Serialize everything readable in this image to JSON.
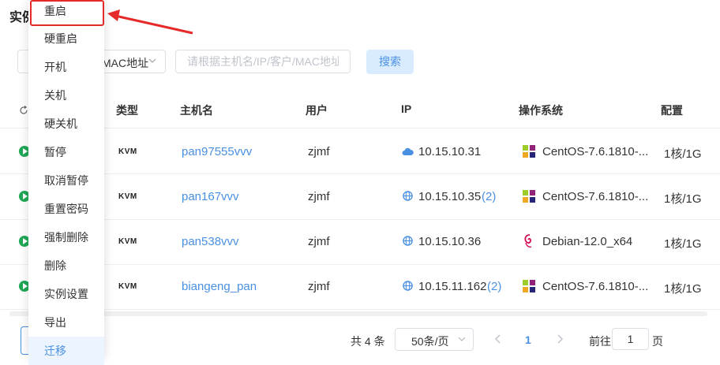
{
  "page": {
    "title": "实例"
  },
  "filter": {
    "select_value": "MAC地址",
    "search_placeholder": "请根据主机名/IP/客户/MAC地址",
    "search_button": "搜索"
  },
  "table": {
    "headers": {
      "type": "类型",
      "hostname": "主机名",
      "user": "用户",
      "ip": "IP",
      "os": "操作系统",
      "config": "配置"
    },
    "rows": [
      {
        "type": "KVM",
        "hostname": "pan97555vvv",
        "user": "zjmf",
        "ip": "10.15.10.31",
        "ip_count": "",
        "ip_icon": "cloud-icon",
        "os": "CentOS-7.6.1810-...",
        "os_icon": "centos-icon",
        "config": "1核/1G"
      },
      {
        "type": "KVM",
        "hostname": "pan167vvv",
        "user": "zjmf",
        "ip": "10.15.10.35",
        "ip_count": "(2)",
        "ip_icon": "globe-icon",
        "os": "CentOS-7.6.1810-...",
        "os_icon": "centos-icon",
        "config": "1核/1G"
      },
      {
        "type": "KVM",
        "hostname": "pan538vvv",
        "user": "zjmf",
        "ip": "10.15.10.36",
        "ip_count": "",
        "ip_icon": "globe-icon",
        "os": "Debian-12.0_x64",
        "os_icon": "debian-icon",
        "config": "1核/1G"
      },
      {
        "type": "KVM",
        "hostname": "biangeng_pan",
        "user": "zjmf",
        "ip": "10.15.11.162",
        "ip_count": "(2)",
        "ip_icon": "globe-icon",
        "os": "CentOS-7.6.1810-...",
        "os_icon": "centos-icon",
        "config": "1核/1G"
      }
    ]
  },
  "pagination": {
    "total": "共 4 条",
    "page_size": "50条/页",
    "current": "1",
    "goto_label": "前往",
    "goto_value": "1",
    "page_suffix": "页"
  },
  "menu": {
    "items": [
      "重启",
      "硬重启",
      "开机",
      "关机",
      "硬关机",
      "暂停",
      "取消暂停",
      "重置密码",
      "强制删除",
      "删除",
      "实例设置",
      "导出",
      "迁移"
    ],
    "highlighted_index": 0,
    "hovered_index": 12
  },
  "colors": {
    "accent": "#4a90e2",
    "annotation": "#e52a2a",
    "status_running": "#1fa855"
  }
}
